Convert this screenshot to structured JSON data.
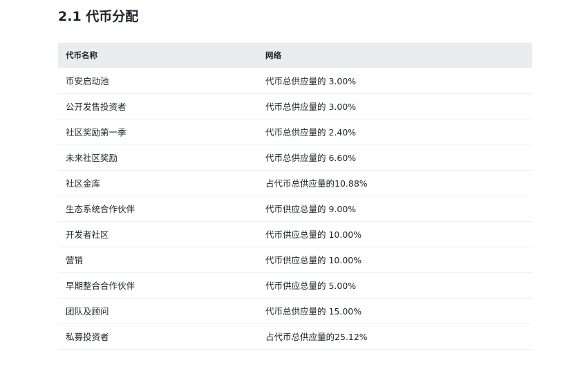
{
  "section": {
    "title": "2.1 代币分配"
  },
  "table": {
    "headers": [
      "代币名称",
      "网络"
    ],
    "rows": [
      [
        "币安启动池",
        "代币总供应量的 3.00%"
      ],
      [
        "公开发售投资者",
        "代币总供应量的 3.00%"
      ],
      [
        "社区奖励第一季",
        "代币总供应量的 2.40%"
      ],
      [
        "未来社区奖励",
        "代币总供应量的 6.60%"
      ],
      [
        "社区金库",
        "占代币总供应量的10.88%"
      ],
      [
        "生态系统合作伙伴",
        "代币供应总量的 9.00%"
      ],
      [
        "开发者社区",
        "代币供应总量的 10.00%"
      ],
      [
        "营销",
        "代币供应总量的 10.00%"
      ],
      [
        "早期整合合作伙伴",
        "代币供应总量的 5.00%"
      ],
      [
        "团队及顾问",
        "代币总供应量的 15.00%"
      ],
      [
        "私募投资者",
        "占代币总供应量的25.12%"
      ]
    ]
  }
}
